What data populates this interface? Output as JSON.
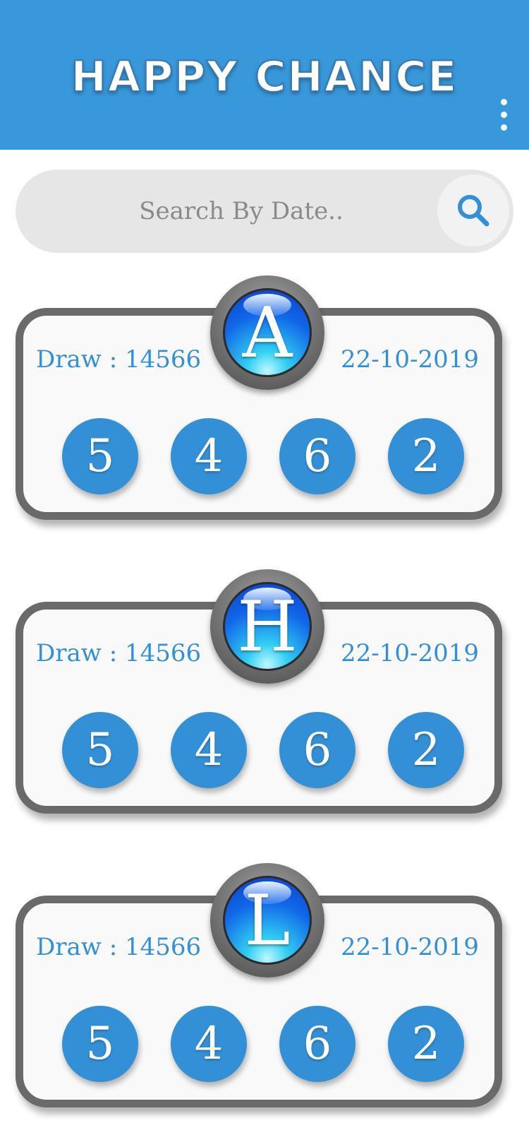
{
  "header": {
    "title": "HAPPY CHANCE",
    "menu_icon": "more-vertical-icon"
  },
  "search": {
    "placeholder": "Search By Date..",
    "icon": "search-icon"
  },
  "colors": {
    "primary": "#3898da",
    "text_blue": "#3490d6",
    "card_border": "#6a6a6a"
  },
  "results": [
    {
      "letter": "A",
      "draw": "Draw : 14566",
      "date": "22-10-2019",
      "numbers": [
        "5",
        "4",
        "6",
        "2"
      ]
    },
    {
      "letter": "H",
      "draw": "Draw : 14566",
      "date": "22-10-2019",
      "numbers": [
        "5",
        "4",
        "6",
        "2"
      ]
    },
    {
      "letter": "L",
      "draw": "Draw : 14566",
      "date": "22-10-2019",
      "numbers": [
        "5",
        "4",
        "6",
        "2"
      ]
    }
  ]
}
